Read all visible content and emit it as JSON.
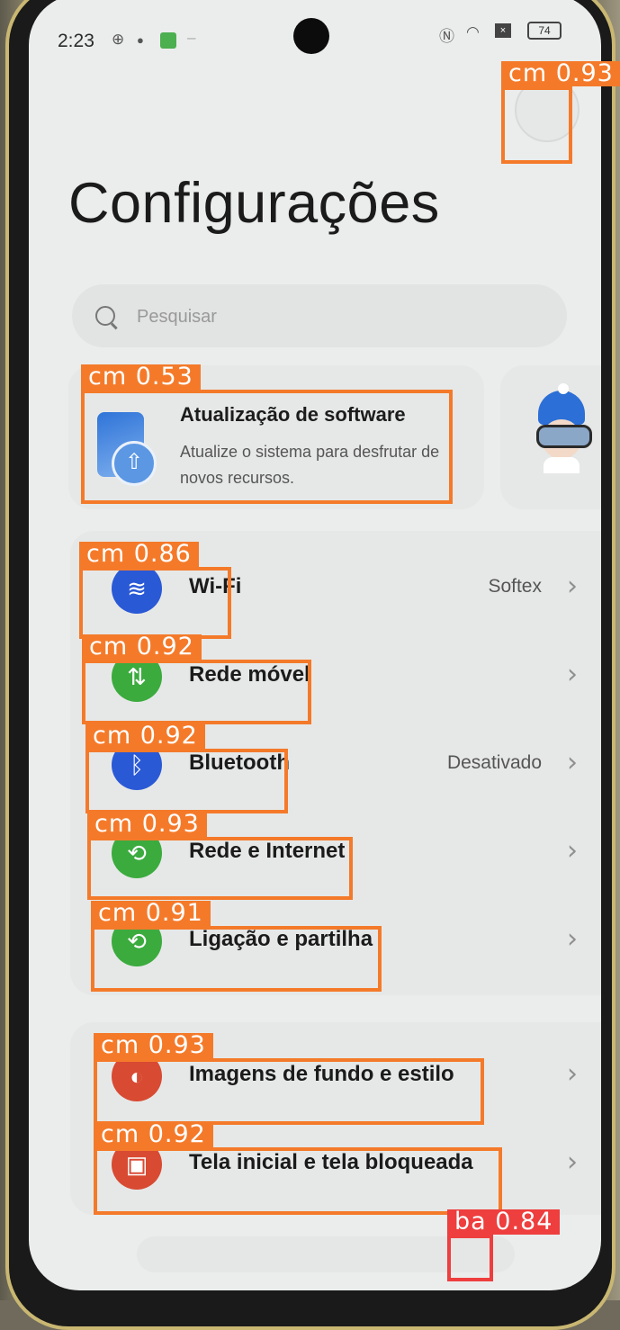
{
  "status_bar": {
    "time": "2:23",
    "battery": "74",
    "icons": [
      "steering-icon",
      "notification-icon",
      "app-icon",
      "nfc-icon",
      "wifi-icon",
      "sim-off-icon",
      "battery-icon"
    ]
  },
  "page": {
    "title": "Configurações"
  },
  "search": {
    "placeholder": "Pesquisar"
  },
  "update_card": {
    "title": "Atualização de software",
    "description": "Atualize o sistema para desfrutar de novos recursos."
  },
  "settings": [
    {
      "label": "Wi-Fi",
      "value": "Softex",
      "icon": "wifi-icon",
      "color": "#2a59d6"
    },
    {
      "label": "Rede móvel",
      "value": "",
      "icon": "mobile-data-icon",
      "color": "#3bab3e"
    },
    {
      "label": "Bluetooth",
      "value": "Desativado",
      "icon": "bluetooth-icon",
      "color": "#2a59d6"
    },
    {
      "label": "Rede e Internet",
      "value": "",
      "icon": "network-icon",
      "color": "#3bab3e"
    },
    {
      "label": "Ligação e partilha",
      "value": "",
      "icon": "sharing-icon",
      "color": "#3bab3e"
    }
  ],
  "settings2": [
    {
      "label": "Imagens de fundo e estilo",
      "icon": "palette-icon",
      "color": "#d84a32"
    },
    {
      "label": "Tela inicial e tela bloqueada",
      "icon": "wallpaper-icon",
      "color": "#d84a32"
    }
  ],
  "detections": [
    {
      "label": "cm 0.93"
    },
    {
      "label": "cm 0.53"
    },
    {
      "label": "cm 0.86"
    },
    {
      "label": "cm 0.92"
    },
    {
      "label": "cm 0.92"
    },
    {
      "label": "cm 0.93"
    },
    {
      "label": "cm 0.91"
    },
    {
      "label": "cm 0.93"
    },
    {
      "label": "cm 0.92"
    },
    {
      "label": "ba 0.84"
    }
  ]
}
